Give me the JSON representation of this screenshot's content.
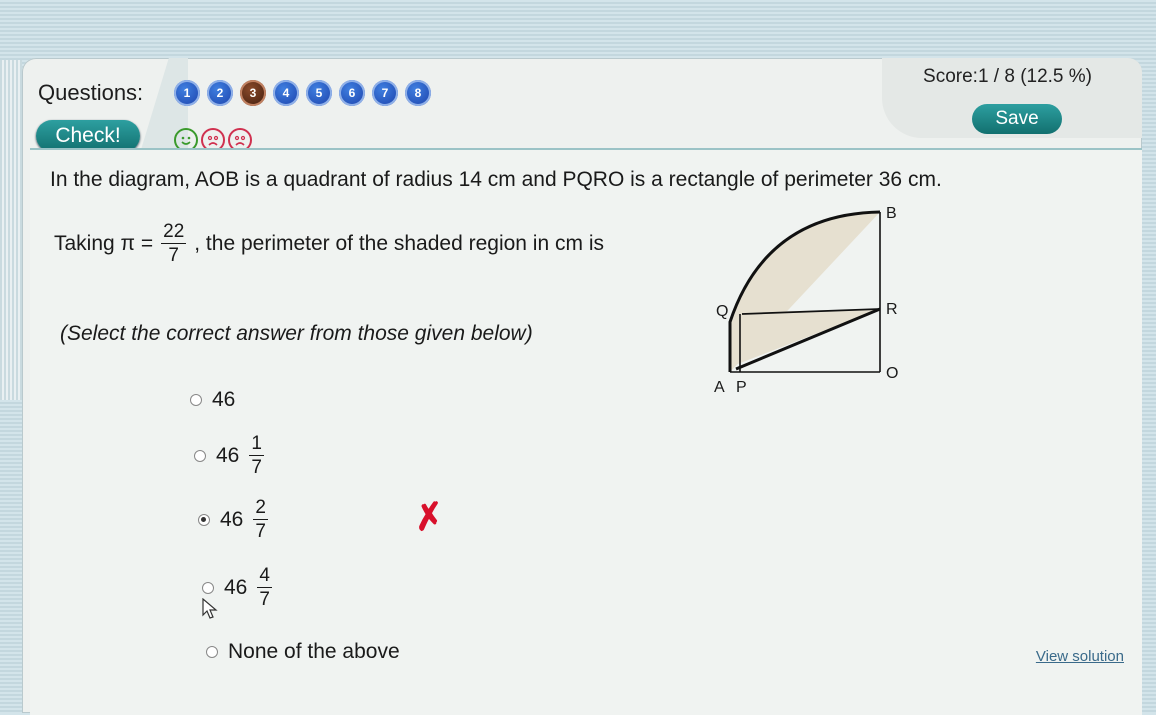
{
  "header": {
    "questions_label": "Questions:",
    "question_numbers": [
      "1",
      "2",
      "3",
      "4",
      "5",
      "6",
      "7",
      "8"
    ],
    "current_question": "3",
    "check_label": "Check!",
    "score_text": "Score:1 / 8  (12.5 %)",
    "save_label": "Save",
    "smileys": [
      "happy-icon",
      "sad-icon",
      "sad-icon"
    ]
  },
  "question": {
    "text": "In the diagram, AOB is a quadrant of radius 14 cm and  PQRO is a rectangle of perimeter 36 cm.",
    "taking_prefix": "Taking π =",
    "pi_num": "22",
    "pi_den": "7",
    "taking_suffix": ", the perimeter of the shaded region in cm is",
    "select_note": "(Select the correct answer from those given below)"
  },
  "options": [
    {
      "whole": "46",
      "num": "",
      "den": ""
    },
    {
      "whole": "46",
      "num": "1",
      "den": "7"
    },
    {
      "whole": "46",
      "num": "2",
      "den": "7"
    },
    {
      "whole": "46",
      "num": "4",
      "den": "7"
    },
    {
      "whole": "None of the above",
      "num": "",
      "den": ""
    }
  ],
  "selected_option_index": 2,
  "wrong_mark": "✗",
  "view_solution_label": "View solution",
  "diagram_labels": {
    "B": "B",
    "Q": "Q",
    "R": "R",
    "O": "O",
    "A": "A",
    "P": "P"
  },
  "colors": {
    "accent_teal": "#1a8a8a",
    "wrong_red": "#d8102b",
    "qnav_blue": "#1f4fc0",
    "current_brown": "#5a2a14"
  }
}
